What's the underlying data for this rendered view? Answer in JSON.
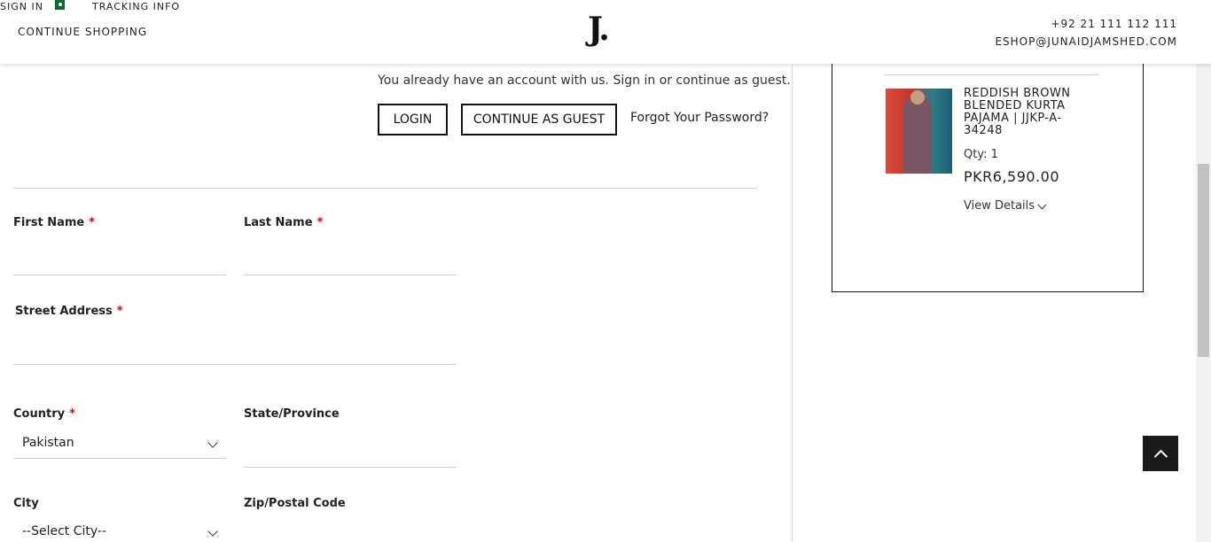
{
  "header": {
    "sign_in": "SIGN IN",
    "tracking": "TRACKING INFO",
    "continue_shopping": "CONTINUE SHOPPING",
    "logo": "J.",
    "phone": "+92 21 111 112 111",
    "email": "ESHOP@JUNAIDJAMSHED.COM"
  },
  "login": {
    "message": "You already have an account with us. Sign in or continue as guest.",
    "login_button": "LOGIN",
    "guest_button": "CONTINUE AS GUEST",
    "forgot_password": "Forgot Your Password?"
  },
  "form": {
    "first_name": "First Name",
    "last_name": "Last Name",
    "street": "Street Address",
    "country": "Country",
    "country_value": "Pakistan",
    "state": "State/Province",
    "city": "City",
    "city_value": "--Select City--",
    "zip": "Zip/Postal Code",
    "required_mark": "*"
  },
  "summary": {
    "product_name": "REDDISH BROWN BLENDED KURTA PAJAMA | JJKP-A-34248",
    "qty": "Qty: 1",
    "price": "PKR6,590.00",
    "view_details": "View Details"
  },
  "colors": {
    "required": "#dd0000",
    "button_border": "#111111"
  },
  "icons": [
    "pakistan-flag-icon",
    "chevron-down-icon",
    "arrow-up-icon"
  ]
}
